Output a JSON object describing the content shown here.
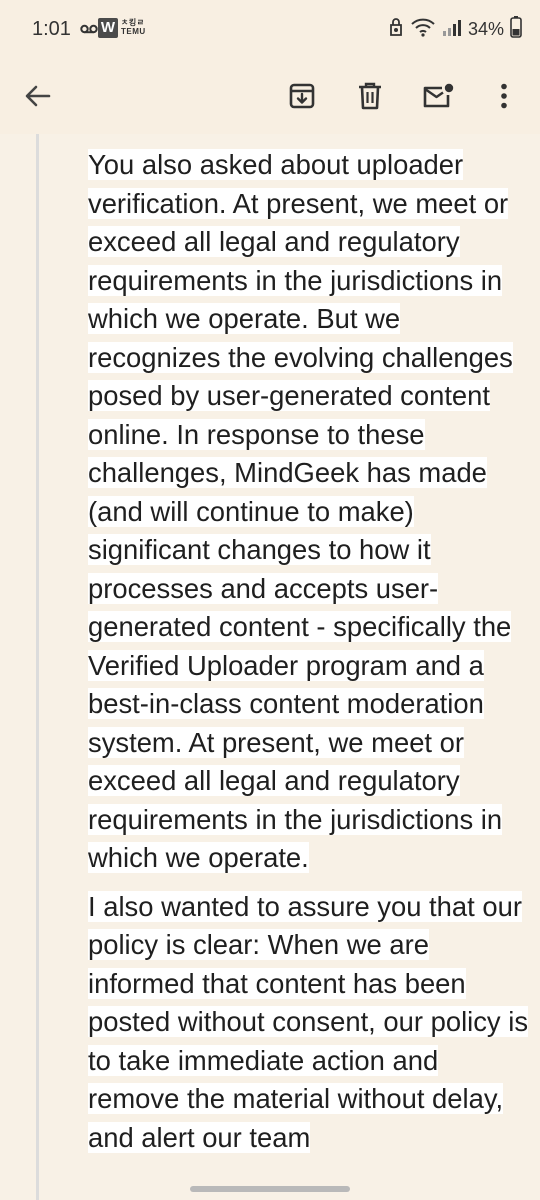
{
  "status_bar": {
    "time": "1:01",
    "app_badge_letter": "W",
    "temu_label_top": "ㅊ킹ㄹ",
    "temu_label_bottom": "TEMU",
    "battery_percent": "34%"
  },
  "toolbar": {
    "back_icon": "arrow-left-icon",
    "archive_icon": "archive-icon",
    "delete_icon": "trash-icon",
    "mark_unread_icon": "mail-unread-icon",
    "more_icon": "more-vertical-icon"
  },
  "email": {
    "paragraphs": [
      "You also asked about uploader verification. At present, we meet or exceed all legal and regulatory requirements in the jurisdictions in which we operate. But we recognizes the evolving challenges posed by user-generated content online. In response to these challenges, MindGeek has made (and will continue to make) significant changes to how it processes and accepts user-generated content - specifically the Verified Uploader program and a best-in-class content moderation system. At present, we meet or exceed all legal and regulatory requirements in the jurisdictions in which we operate.",
      "I also wanted to assure you that our policy is clear: When we are informed that content has been posted without consent, our policy is to take immediate action and remove the material without delay, and alert our team"
    ]
  },
  "colors": {
    "background": "#f8f1e6",
    "toolbar": "#f8efe2",
    "text": "#1f1f1f",
    "highlight": "#ffffff"
  }
}
